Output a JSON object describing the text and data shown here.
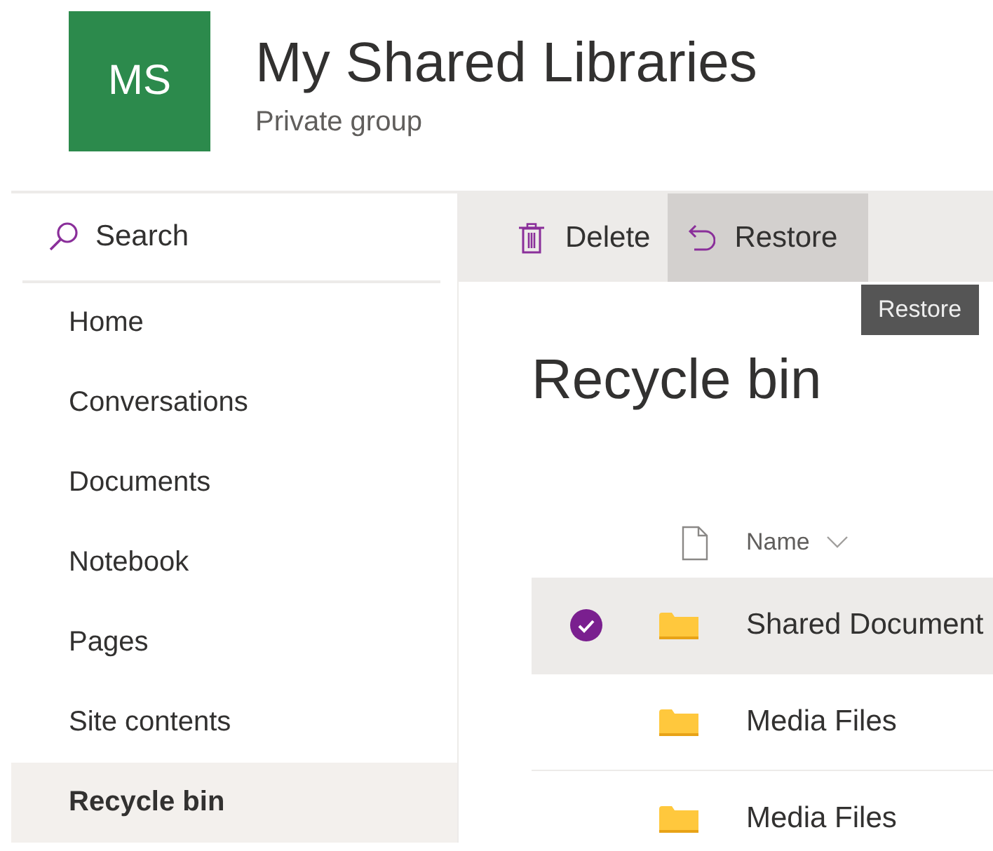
{
  "group": {
    "initials": "MS",
    "title": "My Shared Libraries",
    "subtitle": "Private group"
  },
  "search": {
    "placeholder": "Search"
  },
  "nav": [
    {
      "label": "Home",
      "selected": false
    },
    {
      "label": "Conversations",
      "selected": false
    },
    {
      "label": "Documents",
      "selected": false
    },
    {
      "label": "Notebook",
      "selected": false
    },
    {
      "label": "Pages",
      "selected": false
    },
    {
      "label": "Site contents",
      "selected": false
    },
    {
      "label": "Recycle bin",
      "selected": true
    }
  ],
  "commands": [
    {
      "kind": "delete",
      "label": "Delete",
      "hovered": false
    },
    {
      "kind": "restore",
      "label": "Restore",
      "hovered": true
    }
  ],
  "tooltip": "Restore",
  "heading": "Recycle bin",
  "table": {
    "columns": [
      {
        "kind": "type"
      },
      {
        "kind": "name",
        "label": "Name"
      }
    ],
    "rows": [
      {
        "name": "Shared Document",
        "selected": true
      },
      {
        "name": "Media Files",
        "selected": false
      },
      {
        "name": "Media Files",
        "selected": false
      }
    ]
  }
}
